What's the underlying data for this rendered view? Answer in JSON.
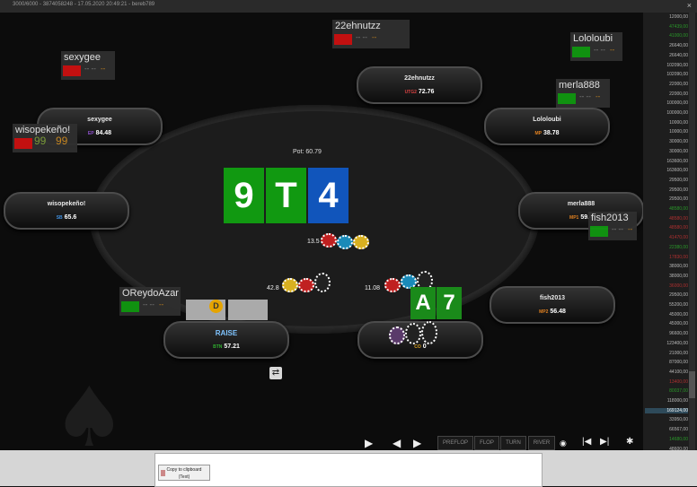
{
  "window": {
    "title": "3000/6000 - 3874058248 - 17.05.2020 20:49:21 - bereb789",
    "close": "×"
  },
  "table": {
    "pot_label": "Pot:",
    "pot_value": "60.79",
    "dealer": "D",
    "board": [
      {
        "rank": "9",
        "color": "#119911"
      },
      {
        "rank": "T",
        "color": "#119911"
      },
      {
        "rank": "4",
        "color": "#1155bb"
      }
    ]
  },
  "seats": [
    {
      "name": "22ehnutzz",
      "pos": "UTG2",
      "stack": "72.76",
      "pos_color": "#d84040"
    },
    {
      "name": "sexygee",
      "pos": "EP",
      "stack": "84.48",
      "pos_color": "#9050d0"
    },
    {
      "name": "Lololoubi",
      "pos": "MP",
      "stack": "38.78",
      "pos_color": "#e08020"
    },
    {
      "name": "wisopekeño!",
      "pos": "SB",
      "stack": "65.6",
      "pos_color": "#4090e0"
    },
    {
      "name": "merla888",
      "pos": "MP1",
      "stack": "59.4",
      "pos_color": "#e08020"
    },
    {
      "name": "fish2013",
      "pos": "MP2",
      "stack": "56.48",
      "pos_color": "#e08020"
    },
    {
      "name": "RAISE",
      "pos": "BTN",
      "stack": "57.21",
      "pos_color": "#30b030"
    },
    {
      "name": "",
      "pos": "CO",
      "stack": "0",
      "pos_color": "#d8a020"
    }
  ],
  "hero_hand": [
    "A",
    "7"
  ],
  "bets": {
    "sb": "13.5",
    "btn": "42.8",
    "co": "11.08"
  },
  "tags": [
    {
      "name": "22ehnutzz",
      "color": "#cc1111",
      "s1": "-- --",
      "s2": "--"
    },
    {
      "name": "sexygee",
      "color": "#cc1111",
      "s1": "-- --",
      "s2": "--"
    },
    {
      "name": "Lololoubi",
      "color": "#119911",
      "s1": "-- --",
      "s2": "--"
    },
    {
      "name": "merla888",
      "color": "#119911",
      "s1": "-- --",
      "s2": "--"
    },
    {
      "name": "wisopekeño!",
      "color": "#cc1111",
      "s1": "99",
      "s2": "99"
    },
    {
      "name": "fish2013",
      "color": "#119911",
      "s1": "-- --",
      "s2": "--"
    },
    {
      "name": "OReydoAzar",
      "color": "#119911",
      "s1": "-- --",
      "s2": "--"
    }
  ],
  "controls": {
    "play": "▶",
    "back": "◀",
    "fwd": "▶",
    "preflop": "PREFLOP",
    "flop": "FLOP",
    "turn": "TURN",
    "river": "RIVER",
    "first": "|◀",
    "last": "▶|",
    "gear": "✱",
    "swap": "⇄"
  },
  "history": [
    {
      "v": "12000,00",
      "c": ""
    },
    {
      "v": "47439,00",
      "c": "g"
    },
    {
      "v": "41000,00",
      "c": "g"
    },
    {
      "v": "26640,00",
      "c": ""
    },
    {
      "v": "26640,00",
      "c": ""
    },
    {
      "v": "102090,00",
      "c": ""
    },
    {
      "v": "102090,00",
      "c": ""
    },
    {
      "v": "22000,00",
      "c": ""
    },
    {
      "v": "22000,00",
      "c": ""
    },
    {
      "v": "100000,00",
      "c": ""
    },
    {
      "v": "100000,00",
      "c": ""
    },
    {
      "v": "10000,00",
      "c": ""
    },
    {
      "v": "10000,00",
      "c": ""
    },
    {
      "v": "30000,00",
      "c": ""
    },
    {
      "v": "30000,00",
      "c": ""
    },
    {
      "v": "163600,00",
      "c": ""
    },
    {
      "v": "163600,00",
      "c": ""
    },
    {
      "v": "29500,00",
      "c": ""
    },
    {
      "v": "29500,00",
      "c": ""
    },
    {
      "v": "29500,00",
      "c": ""
    },
    {
      "v": "48580,00",
      "c": "g"
    },
    {
      "v": "48580,00",
      "c": "r"
    },
    {
      "v": "48580,00",
      "c": "r"
    },
    {
      "v": "41470,00",
      "c": "r"
    },
    {
      "v": "22380,00",
      "c": "g"
    },
    {
      "v": "17830,00",
      "c": "r"
    },
    {
      "v": "38000,00",
      "c": ""
    },
    {
      "v": "38000,00",
      "c": ""
    },
    {
      "v": "36000,00",
      "c": "r"
    },
    {
      "v": "29500,00",
      "c": ""
    },
    {
      "v": "55200,00",
      "c": ""
    },
    {
      "v": "45000,00",
      "c": ""
    },
    {
      "v": "45000,00",
      "c": ""
    },
    {
      "v": "96600,00",
      "c": ""
    },
    {
      "v": "123400,00",
      "c": ""
    },
    {
      "v": "21000,00",
      "c": ""
    },
    {
      "v": "87000,00",
      "c": ""
    },
    {
      "v": "44100,00",
      "c": ""
    },
    {
      "v": "13400,00",
      "c": "r"
    },
    {
      "v": "80037,00",
      "c": "g"
    },
    {
      "v": "118000,00",
      "c": ""
    },
    {
      "v": "169124,00",
      "c": "sel"
    },
    {
      "v": "33950,00",
      "c": ""
    },
    {
      "v": "66567,00",
      "c": ""
    },
    {
      "v": "14680,00",
      "c": "g"
    },
    {
      "v": "48600,00",
      "c": ""
    }
  ],
  "clipboard": {
    "line1": "Copy to clipboard",
    "line2": "(Text)"
  }
}
